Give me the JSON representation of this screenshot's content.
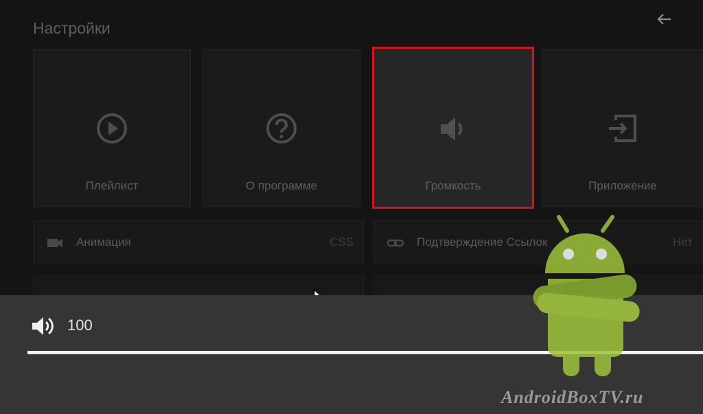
{
  "header": {
    "title": "Настройки"
  },
  "tiles": [
    {
      "label": "Плейлист",
      "icon": "play-circle-icon"
    },
    {
      "label": "О программе",
      "icon": "help-circle-icon"
    },
    {
      "label": "Громкость",
      "icon": "volume-icon"
    },
    {
      "label": "Приложение",
      "icon": "exit-app-icon"
    }
  ],
  "rows": [
    {
      "label": "Анимация",
      "value": "CSS",
      "icon": "video-camera-icon"
    },
    {
      "label": "Подтверждение Ссылок",
      "value": "Нет",
      "icon": "link-icon"
    }
  ],
  "volume": {
    "value": "100",
    "level_percent": 100,
    "icon": "volume-icon"
  },
  "watermark": {
    "text": "AndroidBoxTV.ru"
  },
  "colors": {
    "selected_border": "#d8141a",
    "panel_bg": "#353535",
    "mascot_green": "#9fc43a"
  }
}
